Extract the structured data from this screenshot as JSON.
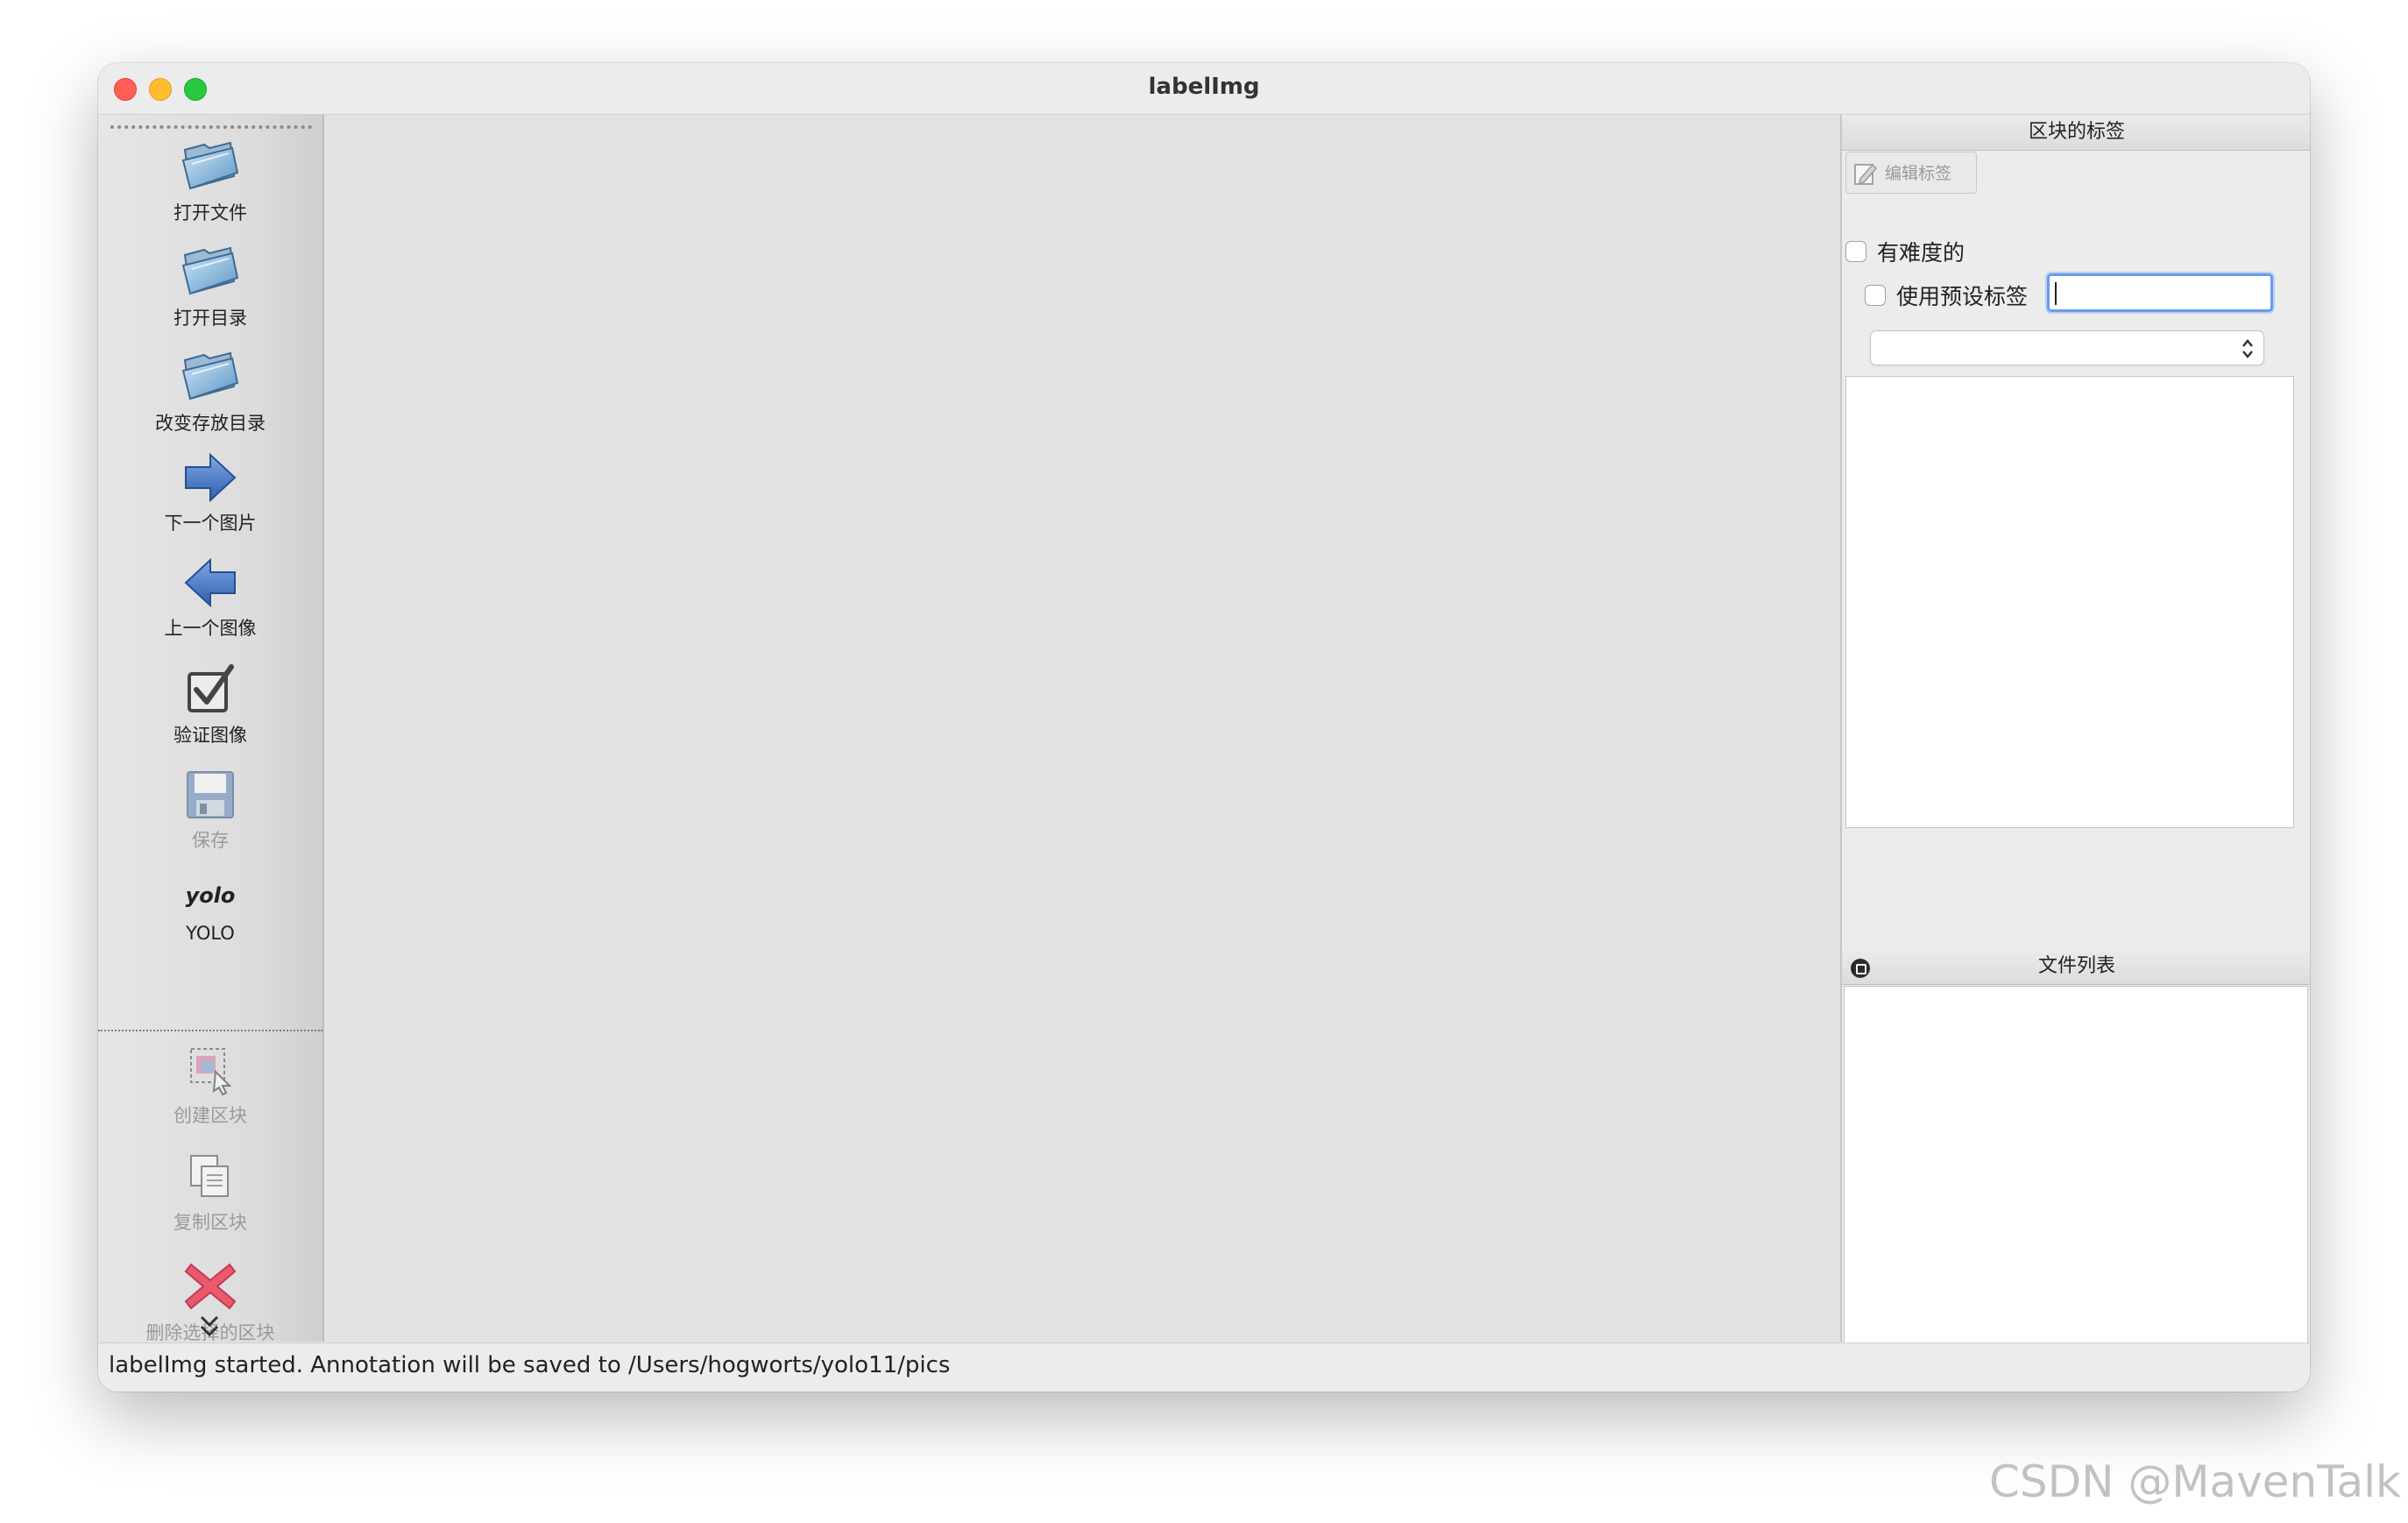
{
  "window": {
    "title": "labelImg"
  },
  "toolbar": {
    "items": [
      {
        "label": "打开文件",
        "icon": "folder-open-icon",
        "enabled": true
      },
      {
        "label": "打开目录",
        "icon": "folder-open-icon",
        "enabled": true
      },
      {
        "label": "改变存放目录",
        "icon": "folder-open-icon",
        "enabled": true
      },
      {
        "label": "下一个图片",
        "icon": "arrow-right-icon",
        "enabled": true
      },
      {
        "label": "上一个图像",
        "icon": "arrow-left-icon",
        "enabled": true
      },
      {
        "label": "验证图像",
        "icon": "checkbox-icon",
        "enabled": true
      },
      {
        "label": "保存",
        "icon": "floppy-disk-icon",
        "enabled": false
      },
      {
        "label": "YOLO",
        "icon_text": "yolo",
        "enabled": true
      },
      {
        "label": "创建区块",
        "icon": "create-box-icon",
        "enabled": false
      },
      {
        "label": "复制区块",
        "icon": "copy-box-icon",
        "enabled": false
      },
      {
        "label": "删除选择的区块",
        "icon": "delete-x-icon",
        "enabled": false
      }
    ],
    "more_icon": "chevron-double-down-icon"
  },
  "label_dock": {
    "title": "区块的标签",
    "edit_button": "编辑标签",
    "difficult_label": "有难度的",
    "use_default_label": "使用预设标签",
    "default_label_value": "",
    "combo_value": ""
  },
  "file_dock": {
    "title": "文件列表"
  },
  "status": {
    "text": "labelImg started. Annotation will be saved to /Users/hogworts/yolo11/pics"
  },
  "watermark": "CSDN @MavenTalk",
  "colors": {
    "close": "#ff5f57",
    "minimize": "#febc2e",
    "maximize": "#28c840",
    "focus_ring": "#6a9ce8",
    "delete_icon": "#e84a5f",
    "arrow_icon": "#3a6fc4"
  }
}
